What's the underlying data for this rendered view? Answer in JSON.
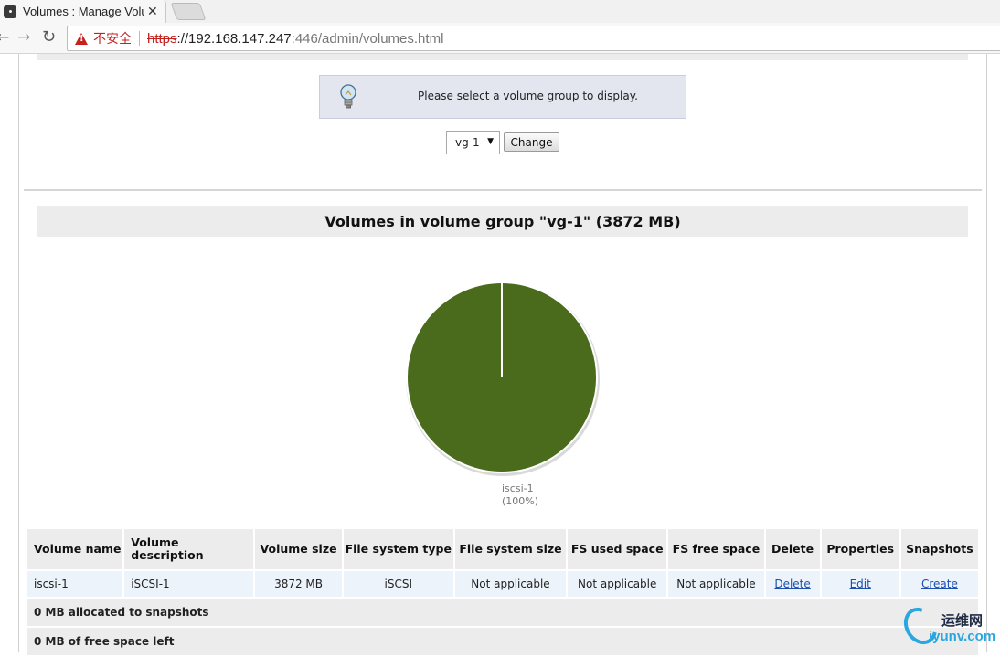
{
  "browser": {
    "tab_title": "Volumes : Manage Volu",
    "security_label": "不安全",
    "url_scheme": "https",
    "url_host": "://192.168.147.247",
    "url_rest": ":446/admin/volumes.html"
  },
  "info": {
    "message": "Please select a volume group to display."
  },
  "selector": {
    "selected": "vg-1",
    "change_label": "Change"
  },
  "section": {
    "title": "Volumes in volume group \"vg-1\" (3872 MB)"
  },
  "chart_data": {
    "type": "pie",
    "slices": [
      {
        "label": "iscsi-1",
        "value": 100,
        "color": "#4a6a1c"
      }
    ],
    "labels": [
      "iscsi-1",
      "(100%)"
    ]
  },
  "table": {
    "headers": [
      "Volume name",
      "Volume description",
      "Volume size",
      "File system type",
      "File system size",
      "FS used space",
      "FS free space",
      "Delete",
      "Properties",
      "Snapshots"
    ],
    "rows": [
      {
        "name": "iscsi-1",
        "description": "iSCSI-1",
        "size": "3872 MB",
        "fs_type": "iSCSI",
        "fs_size": "Not applicable",
        "fs_used": "Not applicable",
        "fs_free": "Not applicable",
        "delete": "Delete",
        "properties": "Edit",
        "snapshots": "Create"
      }
    ],
    "summary": [
      "0 MB allocated to snapshots",
      "0 MB of free space left"
    ]
  },
  "watermark": {
    "cn": "运维网",
    "en": "iyunv.com"
  },
  "colors": {
    "pie": "#4a6a1c",
    "link": "#1a4fb0",
    "header_bg": "#ececec",
    "row_bg": "#edf3fb",
    "info_bg": "#e3e5ef"
  },
  "icons": [
    "close-icon",
    "back-icon",
    "forward-icon",
    "reload-icon",
    "warning-icon",
    "bulb-icon"
  ]
}
